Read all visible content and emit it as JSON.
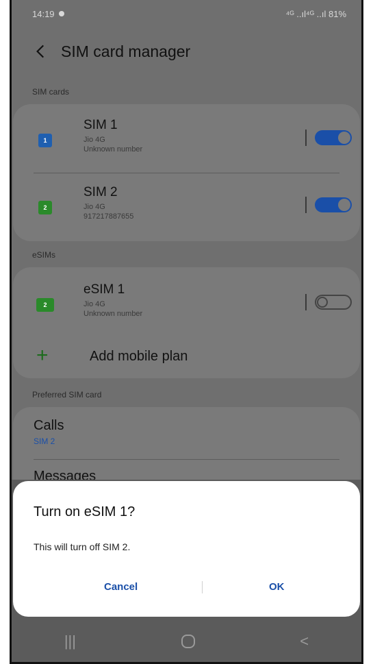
{
  "status": {
    "time": "14:19",
    "right": "⁴ᴳ ..ıl⁴ᴳ ..ıl 81%"
  },
  "header": {
    "title": "SIM card manager"
  },
  "sections": {
    "sim_cards": "SIM cards",
    "esims": "eSIMs",
    "preferred": "Preferred SIM card"
  },
  "sims": [
    {
      "title": "SIM 1",
      "badge": "1",
      "carrier": "Jio 4G",
      "number": "Unknown number",
      "enabled": true,
      "color": "#1f5fb0"
    },
    {
      "title": "SIM 2",
      "badge": "2",
      "carrier": "Jio 4G",
      "number": "917217887655",
      "enabled": true,
      "color": "#2a8a2a"
    }
  ],
  "esim": {
    "title": "eSIM 1",
    "badge": "2",
    "carrier": "Jio 4G",
    "number": "Unknown number",
    "enabled": false,
    "color": "#2a8a2a"
  },
  "add_plan": {
    "label": "Add mobile plan"
  },
  "preferred": {
    "calls_title": "Calls",
    "calls_value": "SIM 2",
    "messages_title": "Messages"
  },
  "dialog": {
    "title": "Turn on eSIM 1?",
    "message": "This will turn off SIM 2.",
    "cancel": "Cancel",
    "ok": "OK"
  },
  "nav": {
    "recents": "|||",
    "back": "<"
  },
  "colors": {
    "accent": "#1a4fa8",
    "toggle_on": "#1a4fa8",
    "plus": "#1d6b1d"
  }
}
